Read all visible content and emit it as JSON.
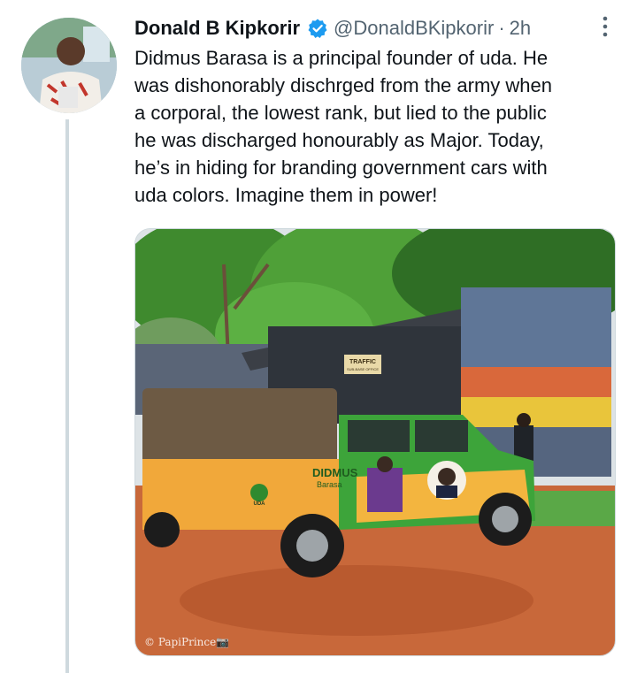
{
  "tweet": {
    "author_name": "Donald B Kipkorir",
    "handle": "@DonaldBKipkorir",
    "separator": "·",
    "time": "2h",
    "text": "Didmus Barasa is a principal founder of uda. He\nwas dishonorably dischrged from the army when\na corporal, the lowest rank, but lied to the public\nhe was discharged honourably as Major. Today,\nhe’s in hiding for branding government cars with\nuda colors. Imagine them in power!"
  },
  "media": {
    "building_sign": "TRAFFIC",
    "building_sign_sub": "SUB-BASE OFFICE",
    "vehicle_branding": "DIDMUS",
    "vehicle_branding_sub": "Barasa",
    "party_logo": "UDA",
    "watermark": "© PapiPrince📷"
  },
  "colors": {
    "verified": "#1d9bf0",
    "secondary_text": "#536471",
    "thread_line": "#cfd9de"
  },
  "icons": {
    "verified": "verified-badge-icon",
    "more": "more-options-icon"
  }
}
